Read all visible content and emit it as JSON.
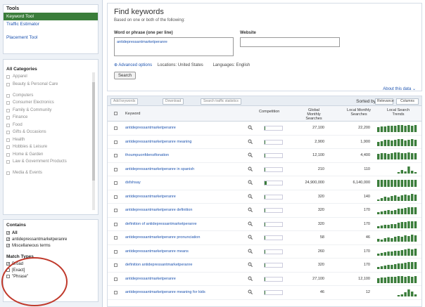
{
  "sidebar": {
    "tools_heading": "Tools",
    "tools": [
      {
        "label": "Keyword Tool",
        "active": true
      },
      {
        "label": "Traffic Estimator",
        "active": false
      }
    ],
    "saved_label": "Placement Tool",
    "categories_heading": "All Categories",
    "categories": [
      "Apparel",
      "Beauty & Personal Care",
      "Computers",
      "Consumer Electronics",
      "Family & Community",
      "Finance",
      "Food",
      "Gifts & Occasions",
      "Health",
      "Hobbies & Leisure",
      "Home & Garden",
      "Law & Government Products",
      "Media & Events"
    ],
    "contains_heading": "Contains",
    "contains": [
      {
        "label": "All",
        "checked": true
      },
      {
        "label": "antidepressantmarketperanre",
        "checked": true
      },
      {
        "label": "Miscellaneous terms",
        "checked": true
      }
    ],
    "match_types_heading": "Match Types",
    "match_types": [
      {
        "label": "Broad",
        "checked": true
      },
      {
        "label": "[Exact]",
        "checked": false
      },
      {
        "label": "\"Phrase\"",
        "checked": false
      }
    ]
  },
  "find": {
    "title": "Find keywords",
    "subtitle": "Based on one or both of the following:",
    "word_label": "Word or phrase (one per line)",
    "word_value": "antidepressantmarketperanre",
    "website_label": "Website",
    "advanced_link": "Advanced options",
    "locations": "Locations: United States",
    "languages": "Languages: English",
    "search_button": "Search",
    "about_link": "About this data"
  },
  "toolbar": {
    "add_keywords": "Add keywords",
    "download": "Download",
    "search_traffic": "Search traffic statistics",
    "sorted_by": "Sorted by",
    "sort_value": "Relevance",
    "columns": "Columns"
  },
  "table": {
    "headers": {
      "keyword": "Keyword",
      "competition": "Competition",
      "global": "Global Monthly Searches",
      "local": "Local Monthly Searches",
      "trends": "Local Search Trends"
    },
    "rows": [
      {
        "keyword": "antidepressantmarketperanre",
        "competition": 0.05,
        "global": "27,100",
        "local": "22,200",
        "trend": [
          7,
          8,
          8,
          9,
          9,
          9,
          10,
          10,
          9,
          10,
          9,
          10
        ]
      },
      {
        "keyword": "antidepressantmarketperanre meaning",
        "competition": 0.05,
        "global": "2,900",
        "local": "1,900",
        "trend": [
          6,
          7,
          9,
          9,
          8,
          9,
          10,
          10,
          8,
          9,
          10,
          9
        ]
      },
      {
        "keyword": "thoumpuonfdenstfonation",
        "competition": 0.05,
        "global": "12,100",
        "local": "4,400",
        "trend": [
          8,
          9,
          9,
          8,
          9,
          10,
          10,
          9,
          9,
          10,
          9,
          9
        ]
      },
      {
        "keyword": "antidepressantmarketperanre in spanish",
        "competition": 0.05,
        "global": "210",
        "local": "110",
        "trend": [
          0,
          0,
          0,
          0,
          0,
          0,
          2,
          5,
          3,
          10,
          4,
          2
        ]
      },
      {
        "keyword": "dsfshsay",
        "competition": 0.1,
        "global": "24,900,000",
        "local": "6,140,000",
        "trend": [
          10,
          10,
          10,
          10,
          10,
          10,
          10,
          10,
          10,
          10,
          10,
          10
        ]
      },
      {
        "keyword": "antidepressantmarketperanre",
        "competition": 0.05,
        "global": "320",
        "local": "140",
        "trend": [
          2,
          4,
          6,
          5,
          7,
          8,
          6,
          8,
          9,
          8,
          10,
          9
        ]
      },
      {
        "keyword": "antidepressantmarketperanre definition",
        "competition": 0.05,
        "global": "320",
        "local": "170",
        "trend": [
          3,
          4,
          5,
          6,
          5,
          6,
          8,
          8,
          9,
          10,
          10,
          10
        ]
      },
      {
        "keyword": "definition of antidepressantmarketperanre",
        "competition": 0.05,
        "global": "320",
        "local": "170",
        "trend": [
          3,
          4,
          5,
          5,
          6,
          6,
          8,
          9,
          9,
          10,
          10,
          10
        ]
      },
      {
        "keyword": "antidepressantmarketperanre pronunciation",
        "competition": 0.05,
        "global": "58",
        "local": "46",
        "trend": [
          4,
          3,
          5,
          6,
          5,
          7,
          8,
          7,
          9,
          8,
          10,
          9
        ]
      },
      {
        "keyword": "antidepressantmarketperanre means",
        "competition": 0.05,
        "global": "260",
        "local": "170",
        "trend": [
          3,
          4,
          5,
          6,
          6,
          7,
          7,
          8,
          9,
          10,
          9,
          10
        ]
      },
      {
        "keyword": "definition antidepressantmarketperanre",
        "competition": 0.05,
        "global": "320",
        "local": "170",
        "trend": [
          3,
          4,
          5,
          6,
          6,
          7,
          8,
          8,
          9,
          10,
          10,
          10
        ]
      },
      {
        "keyword": "antidepressantmarketperanre",
        "competition": 0.05,
        "global": "27,100",
        "local": "12,100",
        "trend": [
          7,
          8,
          8,
          9,
          9,
          9,
          10,
          10,
          9,
          10,
          9,
          10
        ]
      },
      {
        "keyword": "antidepressantmarketperanre meaning for kids",
        "competition": 0.05,
        "global": "46",
        "local": "12",
        "trend": [
          0,
          0,
          0,
          0,
          0,
          0,
          2,
          3,
          6,
          10,
          7,
          3
        ]
      }
    ]
  },
  "colors": {
    "accent_green": "#3a7d3a",
    "link_blue": "#1e54b0",
    "annotation_red": "#c0392b"
  }
}
